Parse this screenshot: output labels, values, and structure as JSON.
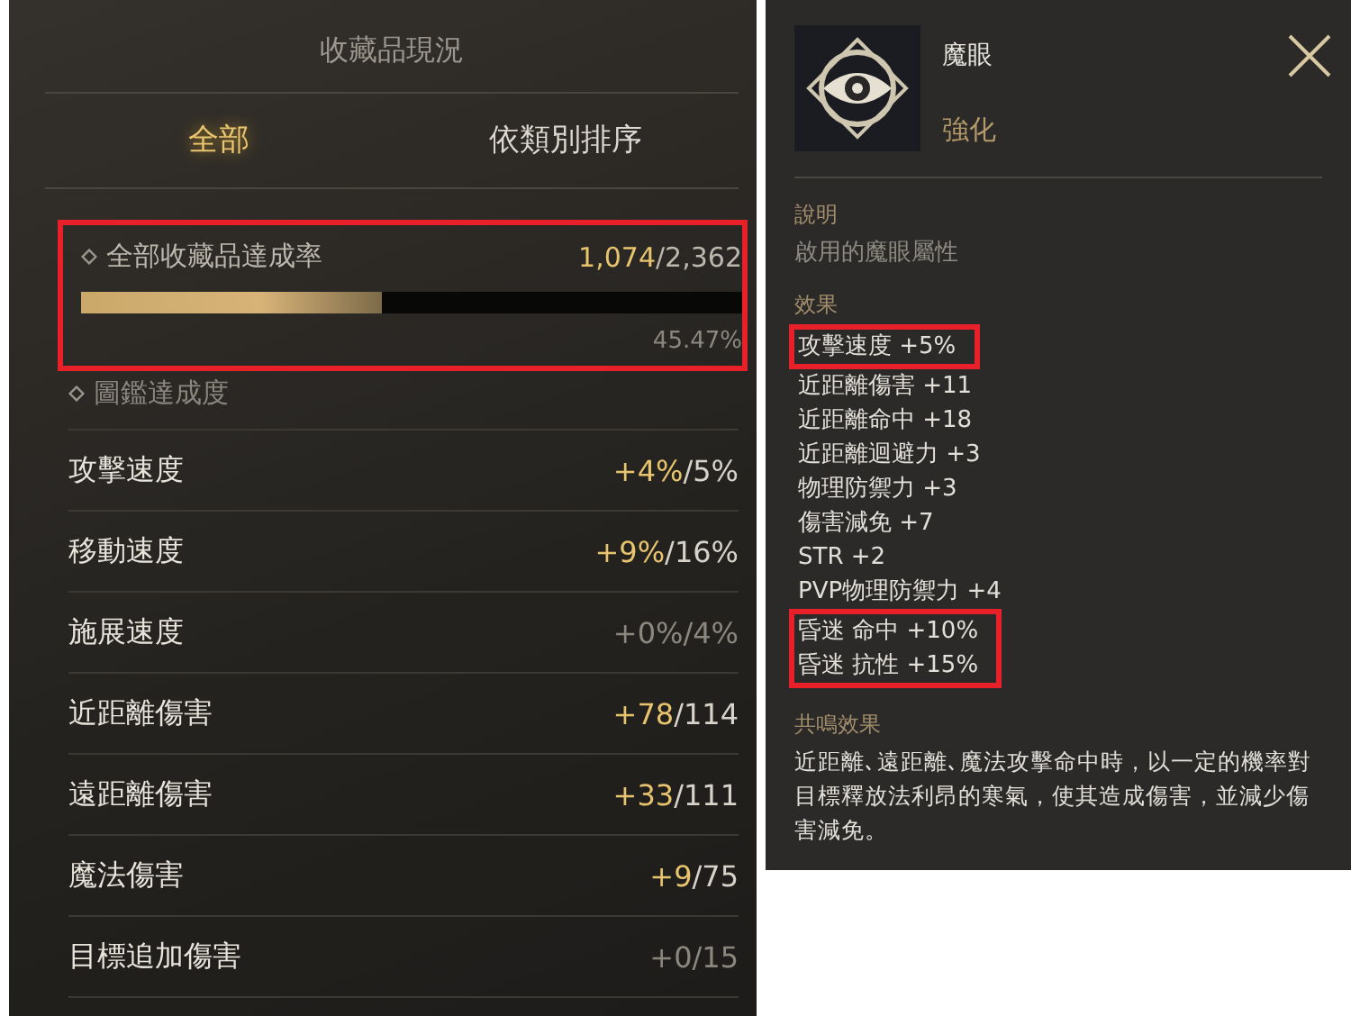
{
  "collection": {
    "title": "收藏品現況",
    "tabs": [
      {
        "label": "全部",
        "selected": true
      },
      {
        "label": "依類別排序",
        "selected": false
      }
    ],
    "overall": {
      "label": "全部收藏品達成率",
      "current": "1,074",
      "total": "/2,362",
      "level": 0.4547,
      "percent": "45.47%",
      "highlighted": true
    },
    "section": {
      "label": "圖鑑達成度"
    },
    "stats": [
      {
        "name": "攻擊速度",
        "bonus": "+4%",
        "max": "/5%",
        "active": true
      },
      {
        "name": "移動速度",
        "bonus": "+9%",
        "max": "/16%",
        "active": true
      },
      {
        "name": "施展速度",
        "bonus": "+0%",
        "max": "/4%",
        "active": false
      },
      {
        "name": "近距離傷害",
        "bonus": "+78",
        "max": "/114",
        "active": true
      },
      {
        "name": "遠距離傷害",
        "bonus": "+33",
        "max": "/111",
        "active": true
      },
      {
        "name": "魔法傷害",
        "bonus": "+9",
        "max": "/75",
        "active": true
      },
      {
        "name": "目標追加傷害",
        "bonus": "+0",
        "max": "/15",
        "active": false
      }
    ]
  },
  "detail": {
    "name": "魔眼",
    "grade": "強化",
    "description_label": "說明",
    "description": "啟用的魔眼屬性",
    "effects_label": "效果",
    "effects": [
      {
        "text": "攻擊速度 +5%",
        "highlighted": true
      },
      {
        "text": "近距離傷害 +11",
        "highlighted": false
      },
      {
        "text": "近距離命中 +18",
        "highlighted": false
      },
      {
        "text": "近距離迴避力 +3",
        "highlighted": false
      },
      {
        "text": "物理防禦力 +3",
        "highlighted": false
      },
      {
        "text": "傷害減免 +7",
        "highlighted": false
      },
      {
        "text": "STR +2",
        "highlighted": false
      },
      {
        "text": "PVP物理防禦力 +4",
        "highlighted": false
      },
      {
        "text": "昏迷 命中 +10%",
        "highlighted": true
      },
      {
        "text": "昏迷 抗性 +15%",
        "highlighted": true
      }
    ],
    "resonance_label": "共鳴效果",
    "resonance": "近距離､遠距離､魔法攻擊命中時，以一定的機率對目標釋放法利昂的寒氣，使其造成傷害，並減少傷害減免。"
  }
}
